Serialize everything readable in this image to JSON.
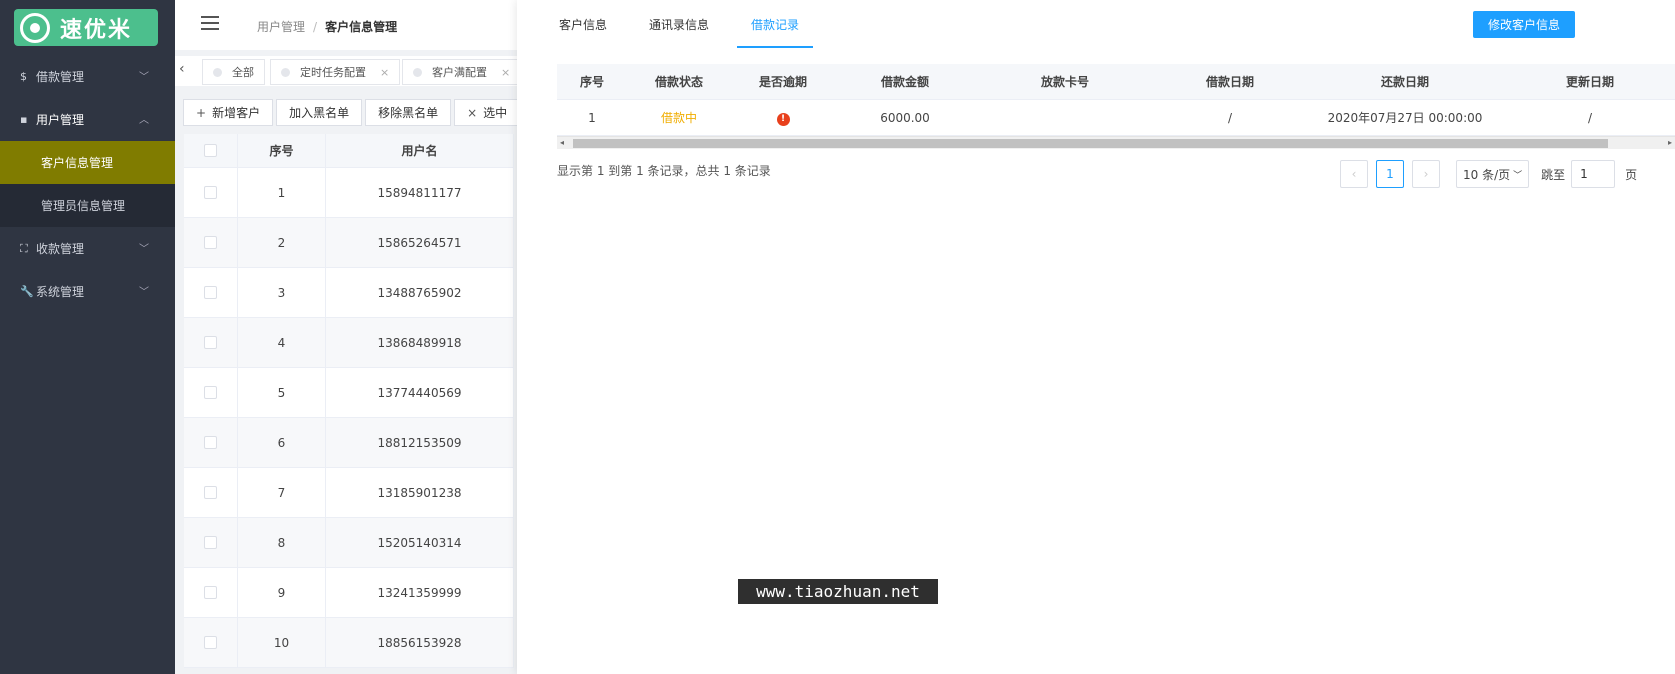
{
  "brand": {
    "name": "速优米",
    "accent": "#4cbf8d"
  },
  "sidebar": {
    "items": [
      {
        "icon": "$",
        "label": "借款管理"
      },
      {
        "icon": "▪",
        "label": "用户管理"
      },
      {
        "icon": "⛶",
        "label": "收款管理"
      },
      {
        "icon": "🔧",
        "label": "系统管理"
      }
    ],
    "user_sub": [
      {
        "label": "客户信息管理"
      },
      {
        "label": "管理员信息管理"
      }
    ]
  },
  "breadcrumb": {
    "parent": "用户管理",
    "sep": "/",
    "current": "客户信息管理"
  },
  "page_tabs": [
    {
      "label": "全部"
    },
    {
      "label": "定时任务配置",
      "close": "×"
    },
    {
      "label": "客户满配置",
      "close": "×"
    }
  ],
  "toolbar": {
    "add": "新增客户",
    "add_icon": "+",
    "blacklist_add": "加入黑名单",
    "blacklist_remove": "移除黑名单",
    "selected": "选中",
    "selected_icon": "×"
  },
  "customers": {
    "headers": {
      "index": "序号",
      "username": "用户名"
    },
    "rows": [
      {
        "index": "1",
        "username": "15894811177"
      },
      {
        "index": "2",
        "username": "15865264571"
      },
      {
        "index": "3",
        "username": "13488765902"
      },
      {
        "index": "4",
        "username": "13868489918"
      },
      {
        "index": "5",
        "username": "13774440569"
      },
      {
        "index": "6",
        "username": "18812153509"
      },
      {
        "index": "7",
        "username": "13185901238"
      },
      {
        "index": "8",
        "username": "15205140314"
      },
      {
        "index": "9",
        "username": "13241359999"
      },
      {
        "index": "10",
        "username": "18856153928"
      }
    ]
  },
  "panel": {
    "tabs": [
      {
        "label": "客户信息"
      },
      {
        "label": "通讯录信息"
      },
      {
        "label": "借款记录"
      }
    ],
    "active_tab": "借款记录",
    "edit_button": "修改客户信息",
    "loan_table": {
      "headers": [
        "序号",
        "借款状态",
        "是否逾期",
        "借款金额",
        "放款卡号",
        "借款日期",
        "还款日期",
        "更新日期"
      ],
      "rows": [
        {
          "index": "1",
          "status": "借款中",
          "overdue_icon": "!",
          "amount": "6000.00",
          "card": "",
          "loan_date": "/",
          "repay_date": "2020年07月27日 00:00:00",
          "update_date": "/"
        }
      ]
    },
    "pagination": {
      "info": "显示第 1 到第 1 条记录，总共 1 条记录",
      "prev": "‹",
      "current": "1",
      "next": "›",
      "page_size": "10 条/页",
      "jump_label": "跳至",
      "jump_value": "1",
      "page_unit": "页"
    }
  },
  "watermark": "www.tiaozhuan.net"
}
